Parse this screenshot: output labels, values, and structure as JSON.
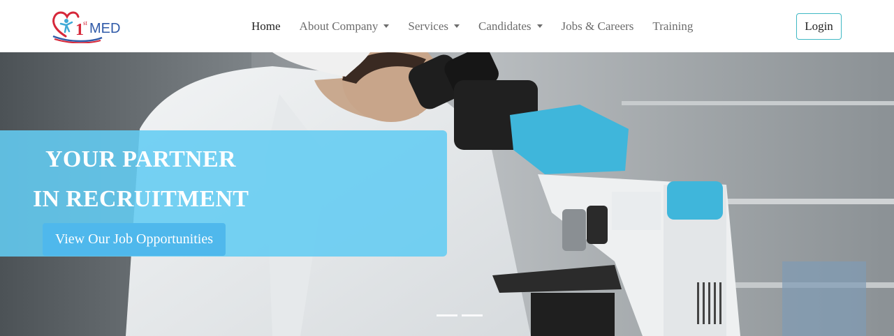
{
  "brand": {
    "logo_text": "1st MED",
    "logo_superscript": "st",
    "logo_word": "MED"
  },
  "nav": {
    "items": [
      {
        "label": "Home",
        "active": true,
        "dropdown": false
      },
      {
        "label": "About Company",
        "active": false,
        "dropdown": true
      },
      {
        "label": "Services",
        "active": false,
        "dropdown": true
      },
      {
        "label": "Candidates",
        "active": false,
        "dropdown": true
      },
      {
        "label": "Jobs & Careers",
        "active": false,
        "dropdown": false
      },
      {
        "label": "Training",
        "active": false,
        "dropdown": false
      }
    ],
    "login_label": "Login"
  },
  "hero": {
    "headline_line1": "YOUR PARTNER",
    "headline_line2": "IN RECRUITMENT",
    "cta_label": "View Our Job Opportunities",
    "slide_count": 2
  },
  "colors": {
    "accent": "#63ccf3",
    "cta": "#4fb8ec",
    "login_border": "#3fb8c4",
    "logo_red": "#d6283a",
    "logo_blue": "#2f5aa8"
  },
  "icons": [
    "logo-icon",
    "dropdown-caret-icon"
  ]
}
